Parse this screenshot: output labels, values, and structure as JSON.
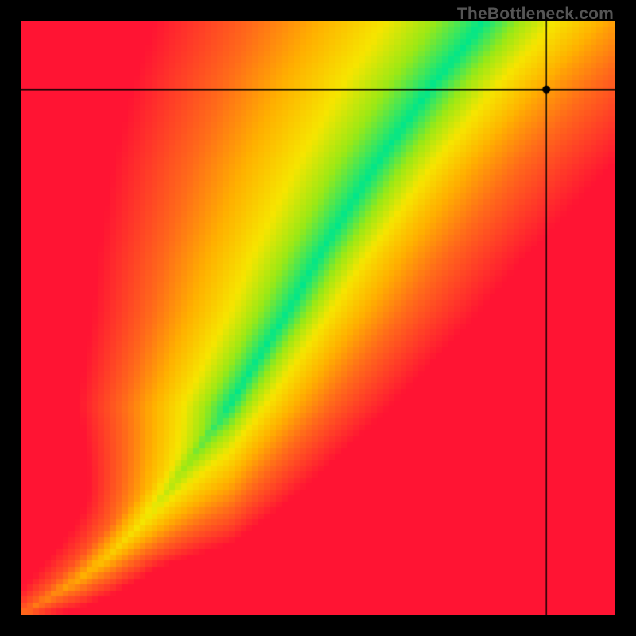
{
  "watermark": "TheBottleneck.com",
  "chart_data": {
    "type": "heatmap",
    "title": "",
    "xlabel": "",
    "ylabel": "",
    "xlim": [
      0,
      1
    ],
    "ylim": [
      0,
      1
    ],
    "grid_size": 100,
    "marker": {
      "x": 0.885,
      "y": 0.885
    },
    "crosshair": {
      "x": 0.885,
      "y": 0.885
    },
    "optimal_curve": {
      "description": "green optimal ridge where GPU matches CPU; y ≈ 0.9*x^1.5 + 0.15*x below ~0.5, steepening above",
      "points": [
        [
          0.0,
          0.0
        ],
        [
          0.05,
          0.03
        ],
        [
          0.1,
          0.06
        ],
        [
          0.15,
          0.1
        ],
        [
          0.2,
          0.15
        ],
        [
          0.25,
          0.21
        ],
        [
          0.3,
          0.28
        ],
        [
          0.35,
          0.35
        ],
        [
          0.4,
          0.43
        ],
        [
          0.45,
          0.51
        ],
        [
          0.5,
          0.6
        ],
        [
          0.55,
          0.68
        ],
        [
          0.6,
          0.76
        ],
        [
          0.65,
          0.83
        ],
        [
          0.7,
          0.9
        ],
        [
          0.75,
          0.96
        ],
        [
          0.78,
          1.0
        ]
      ]
    },
    "optimal_width": 0.06,
    "color_stops": [
      {
        "t": 0.0,
        "color": "#00e68a"
      },
      {
        "t": 0.15,
        "color": "#9be815"
      },
      {
        "t": 0.3,
        "color": "#f6e500"
      },
      {
        "t": 0.5,
        "color": "#ffb000"
      },
      {
        "t": 0.7,
        "color": "#ff6a1a"
      },
      {
        "t": 1.0,
        "color": "#ff1433"
      }
    ]
  }
}
